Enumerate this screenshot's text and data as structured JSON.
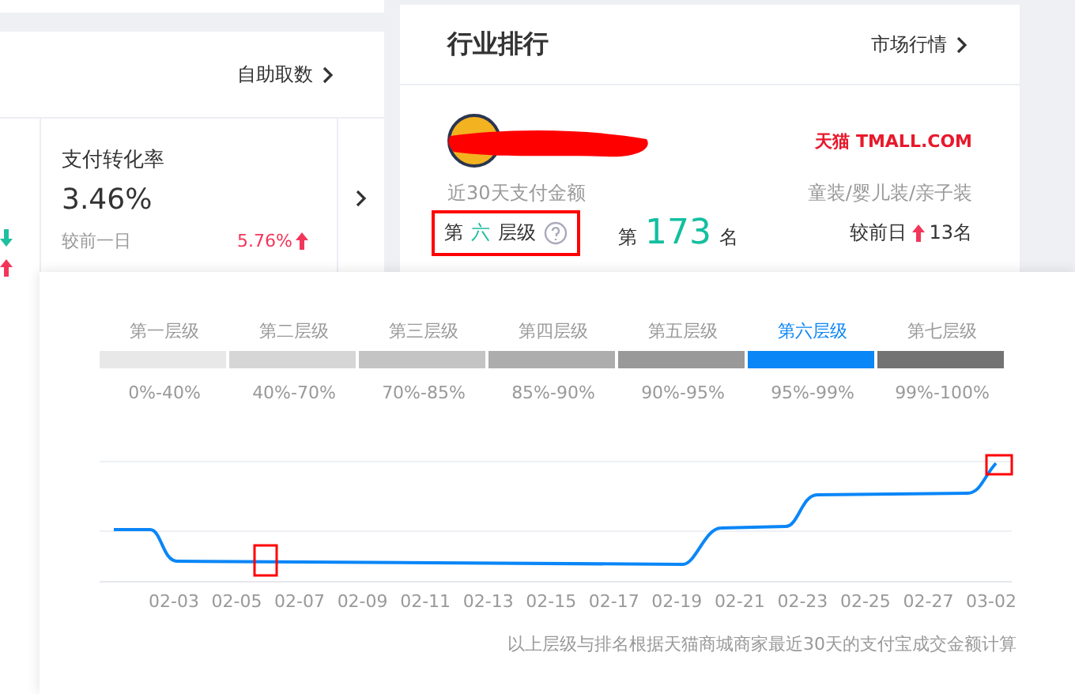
{
  "left_panel": {
    "link": "自助取数",
    "side_trends": [
      {
        "rising": false
      },
      {
        "rising": true
      }
    ],
    "metric": {
      "title": "支付转化率",
      "value": "3.46%",
      "comparisons": [
        {
          "label": "较前一日",
          "value": "5.76%",
          "rising": true
        }
      ]
    }
  },
  "ranking_card": {
    "title": "行业排行",
    "link": "市场行情",
    "platform": {
      "cn": "天猫",
      "en": "TMALL.COM"
    },
    "metric_label": "近30天支付金额",
    "category": "童装/婴儿装/亲子装",
    "tier": {
      "prefix": "第",
      "value": "六",
      "suffix": "层级"
    },
    "rank": {
      "prefix": "第",
      "value": "173",
      "suffix": "名"
    },
    "change": {
      "label": "较前日",
      "value": "13名",
      "rising": true
    }
  },
  "tier_popup": {
    "tiers": [
      {
        "label": "第一层级",
        "range": "0%-40%",
        "color": "#e8e8e8",
        "selected": false
      },
      {
        "label": "第二层级",
        "range": "40%-70%",
        "color": "#d6d6d6",
        "selected": false
      },
      {
        "label": "第三层级",
        "range": "70%-85%",
        "color": "#c4c4c4",
        "selected": false
      },
      {
        "label": "第四层级",
        "range": "85%-90%",
        "color": "#adadad",
        "selected": false
      },
      {
        "label": "第五层级",
        "range": "90%-95%",
        "color": "#999999",
        "selected": false
      },
      {
        "label": "第六层级",
        "range": "95%-99%",
        "color": "#0a86f7",
        "selected": true
      },
      {
        "label": "第七层级",
        "range": "99%-100%",
        "color": "#737373",
        "selected": false
      }
    ],
    "x_labels": [
      "02-03",
      "02-05",
      "02-07",
      "02-09",
      "02-11",
      "02-13",
      "02-15",
      "02-17",
      "02-19",
      "02-21",
      "02-23",
      "02-25",
      "02-27",
      "03-02"
    ],
    "note": "以上层级与排名根据天猫商城商家最近30天的支付宝成交金额计算"
  }
}
